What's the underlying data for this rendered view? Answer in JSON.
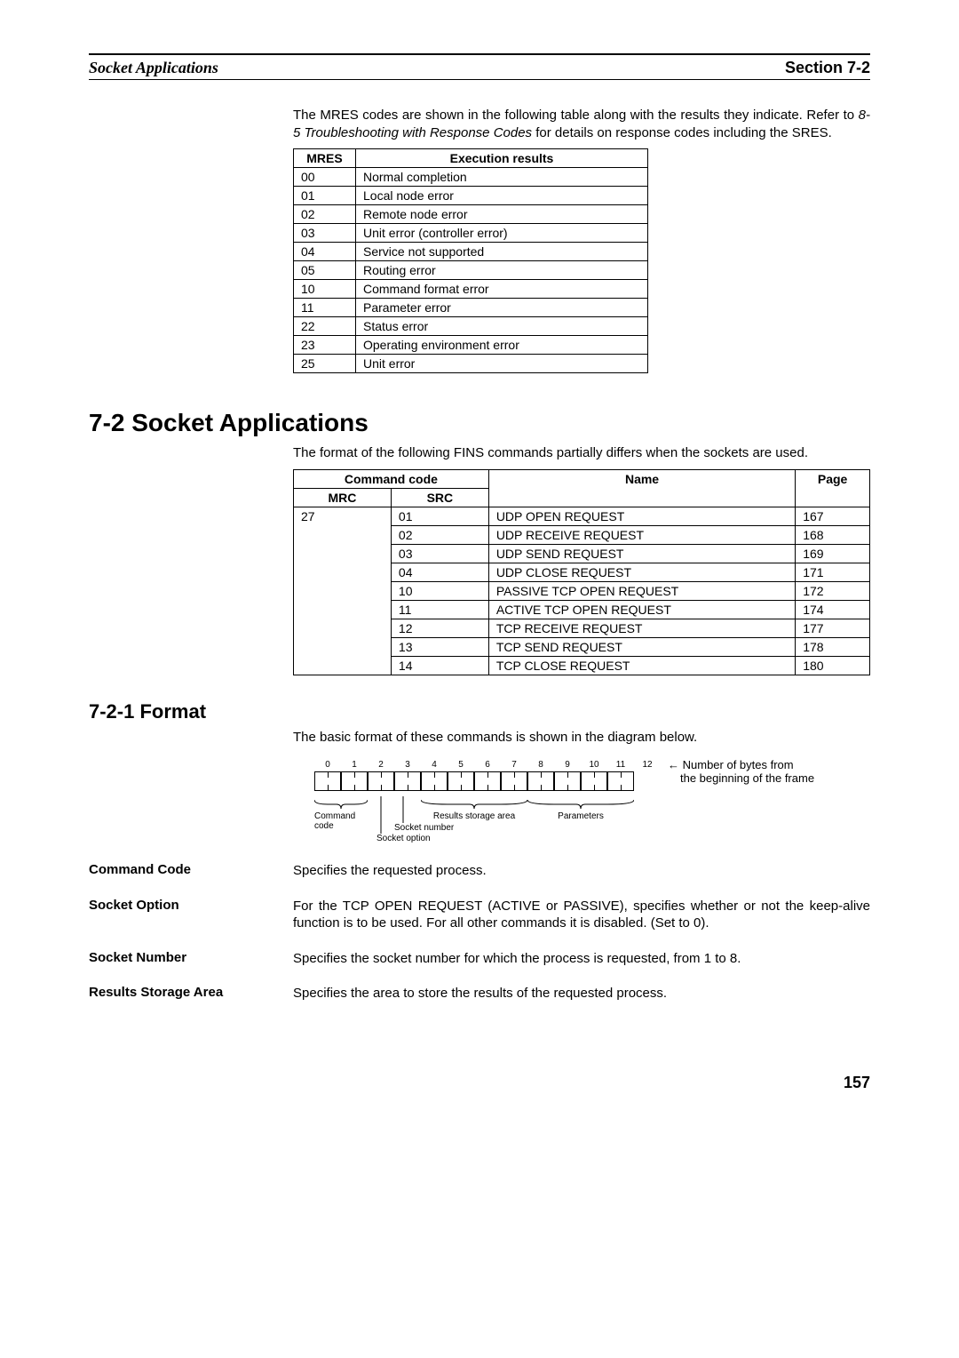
{
  "header": {
    "left": "Socket Applications",
    "right": "Section 7-2"
  },
  "intro": {
    "pre": "The MRES codes are shown in the following table along with the results they indicate. Refer to ",
    "emph": "8-5 Troubleshooting with Response Codes",
    "post": " for details on response codes including the SRES."
  },
  "mres_table": {
    "headers": [
      "MRES",
      "Execution results"
    ],
    "rows": [
      [
        "00",
        "Normal completion"
      ],
      [
        "01",
        "Local node error"
      ],
      [
        "02",
        "Remote node error"
      ],
      [
        "03",
        "Unit error (controller error)"
      ],
      [
        "04",
        "Service not supported"
      ],
      [
        "05",
        "Routing error"
      ],
      [
        "10",
        "Command format error"
      ],
      [
        "11",
        "Parameter error"
      ],
      [
        "22",
        "Status error"
      ],
      [
        "23",
        "Operating environment error"
      ],
      [
        "25",
        "Unit error"
      ]
    ]
  },
  "section72": {
    "heading": "7-2    Socket Applications",
    "intro": "The format of the following FINS commands partially differs when the sockets are used."
  },
  "cmd_table": {
    "header_command_code": "Command code",
    "header_name": "Name",
    "header_page": "Page",
    "header_mrc": "MRC",
    "header_src": "SRC",
    "mrc": "27",
    "rows": [
      [
        "01",
        "UDP OPEN REQUEST",
        "167"
      ],
      [
        "02",
        "UDP RECEIVE REQUEST",
        "168"
      ],
      [
        "03",
        "UDP SEND REQUEST",
        "169"
      ],
      [
        "04",
        "UDP CLOSE REQUEST",
        "171"
      ],
      [
        "10",
        "PASSIVE TCP OPEN REQUEST",
        "172"
      ],
      [
        "11",
        "ACTIVE TCP OPEN REQUEST",
        "174"
      ],
      [
        "12",
        "TCP RECEIVE REQUEST",
        "177"
      ],
      [
        "13",
        "TCP SEND REQUEST",
        "178"
      ],
      [
        "14",
        "TCP CLOSE REQUEST",
        "180"
      ]
    ]
  },
  "section721": {
    "heading": "7-2-1    Format",
    "intro": "The basic format of these commands is shown in the diagram below."
  },
  "diagram": {
    "bytes": [
      "0",
      "1",
      "2",
      "3",
      "4",
      "5",
      "6",
      "7",
      "8",
      "9",
      "10",
      "11",
      "12"
    ],
    "arrow_text1": "Number of bytes from",
    "arrow_text2": "the beginning of the frame",
    "label_command": "Command code",
    "label_results": "Results storage area",
    "label_params": "Parameters",
    "label_socket_num": "Socket number",
    "label_socket_opt": "Socket option"
  },
  "definitions": [
    {
      "label": "Command Code",
      "body": "Specifies the requested process."
    },
    {
      "label": "Socket Option",
      "body": "For the TCP OPEN REQUEST (ACTIVE or PASSIVE), specifies whether or not the keep-alive function is to be used. For all other commands it is disabled. (Set to 0)."
    },
    {
      "label": "Socket Number",
      "body": "Specifies the socket number for which the process is requested, from 1 to 8."
    },
    {
      "label": "Results Storage Area",
      "body": "Specifies the area to store the results of the requested process."
    }
  ],
  "page_number": "157"
}
